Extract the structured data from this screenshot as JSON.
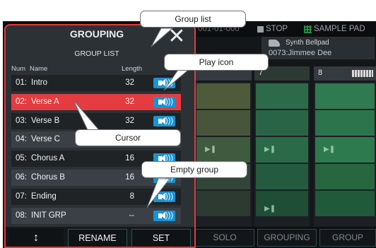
{
  "topbar": {
    "position": "001-01-000",
    "stop_label": "STOP",
    "mode_label": "SAMPLE PAD"
  },
  "instrument": {
    "name": "Synth Bellpad",
    "patch": "0073:Jimmee Dee"
  },
  "tracks": [
    {
      "number": "7"
    },
    {
      "number": "8"
    }
  ],
  "bottom_bar": {
    "solo_label": "SOLO",
    "grouping_label": "GROUPING",
    "group_label": "GROUP"
  },
  "dialog": {
    "title": "GROUPING",
    "close_symbol": "✕",
    "list_header": "GROUP LIST",
    "columns": {
      "num": "Num",
      "name": "Name",
      "length": "Length"
    },
    "rows": [
      {
        "num": "01:",
        "name": "Intro",
        "length": "32",
        "selected": false
      },
      {
        "num": "02:",
        "name": "Verse A",
        "length": "32",
        "selected": true
      },
      {
        "num": "03:",
        "name": "Verse B",
        "length": "32",
        "selected": false
      },
      {
        "num": "04:",
        "name": "Verse C",
        "length": "",
        "selected": false
      },
      {
        "num": "05:",
        "name": "Chorus A",
        "length": "16",
        "selected": false
      },
      {
        "num": "06:",
        "name": "Chorus B",
        "length": "16",
        "selected": false
      },
      {
        "num": "07:",
        "name": "Ending",
        "length": "8",
        "selected": false
      },
      {
        "num": "08:",
        "name": "INIT GRP",
        "length": "--",
        "selected": false
      }
    ],
    "buttons": {
      "sort_symbol": "↕",
      "rename_label": "RENAME",
      "set_label": "SET"
    }
  },
  "callouts": {
    "group_list": "Group list",
    "play_icon": "Play icon",
    "cursor": "Cursor",
    "empty_group": "Empty group"
  },
  "colors": {
    "accent_red": "#e23a3f",
    "play_button_blue": "#1a93d3",
    "selected_row": "#e43c40",
    "row_dark": "#1f2326",
    "row_light": "#3a4046"
  },
  "icons": {
    "play": "speaker-icon",
    "close": "close-icon",
    "sort": "up-down-arrow-icon",
    "instrument": "synth-icon"
  }
}
